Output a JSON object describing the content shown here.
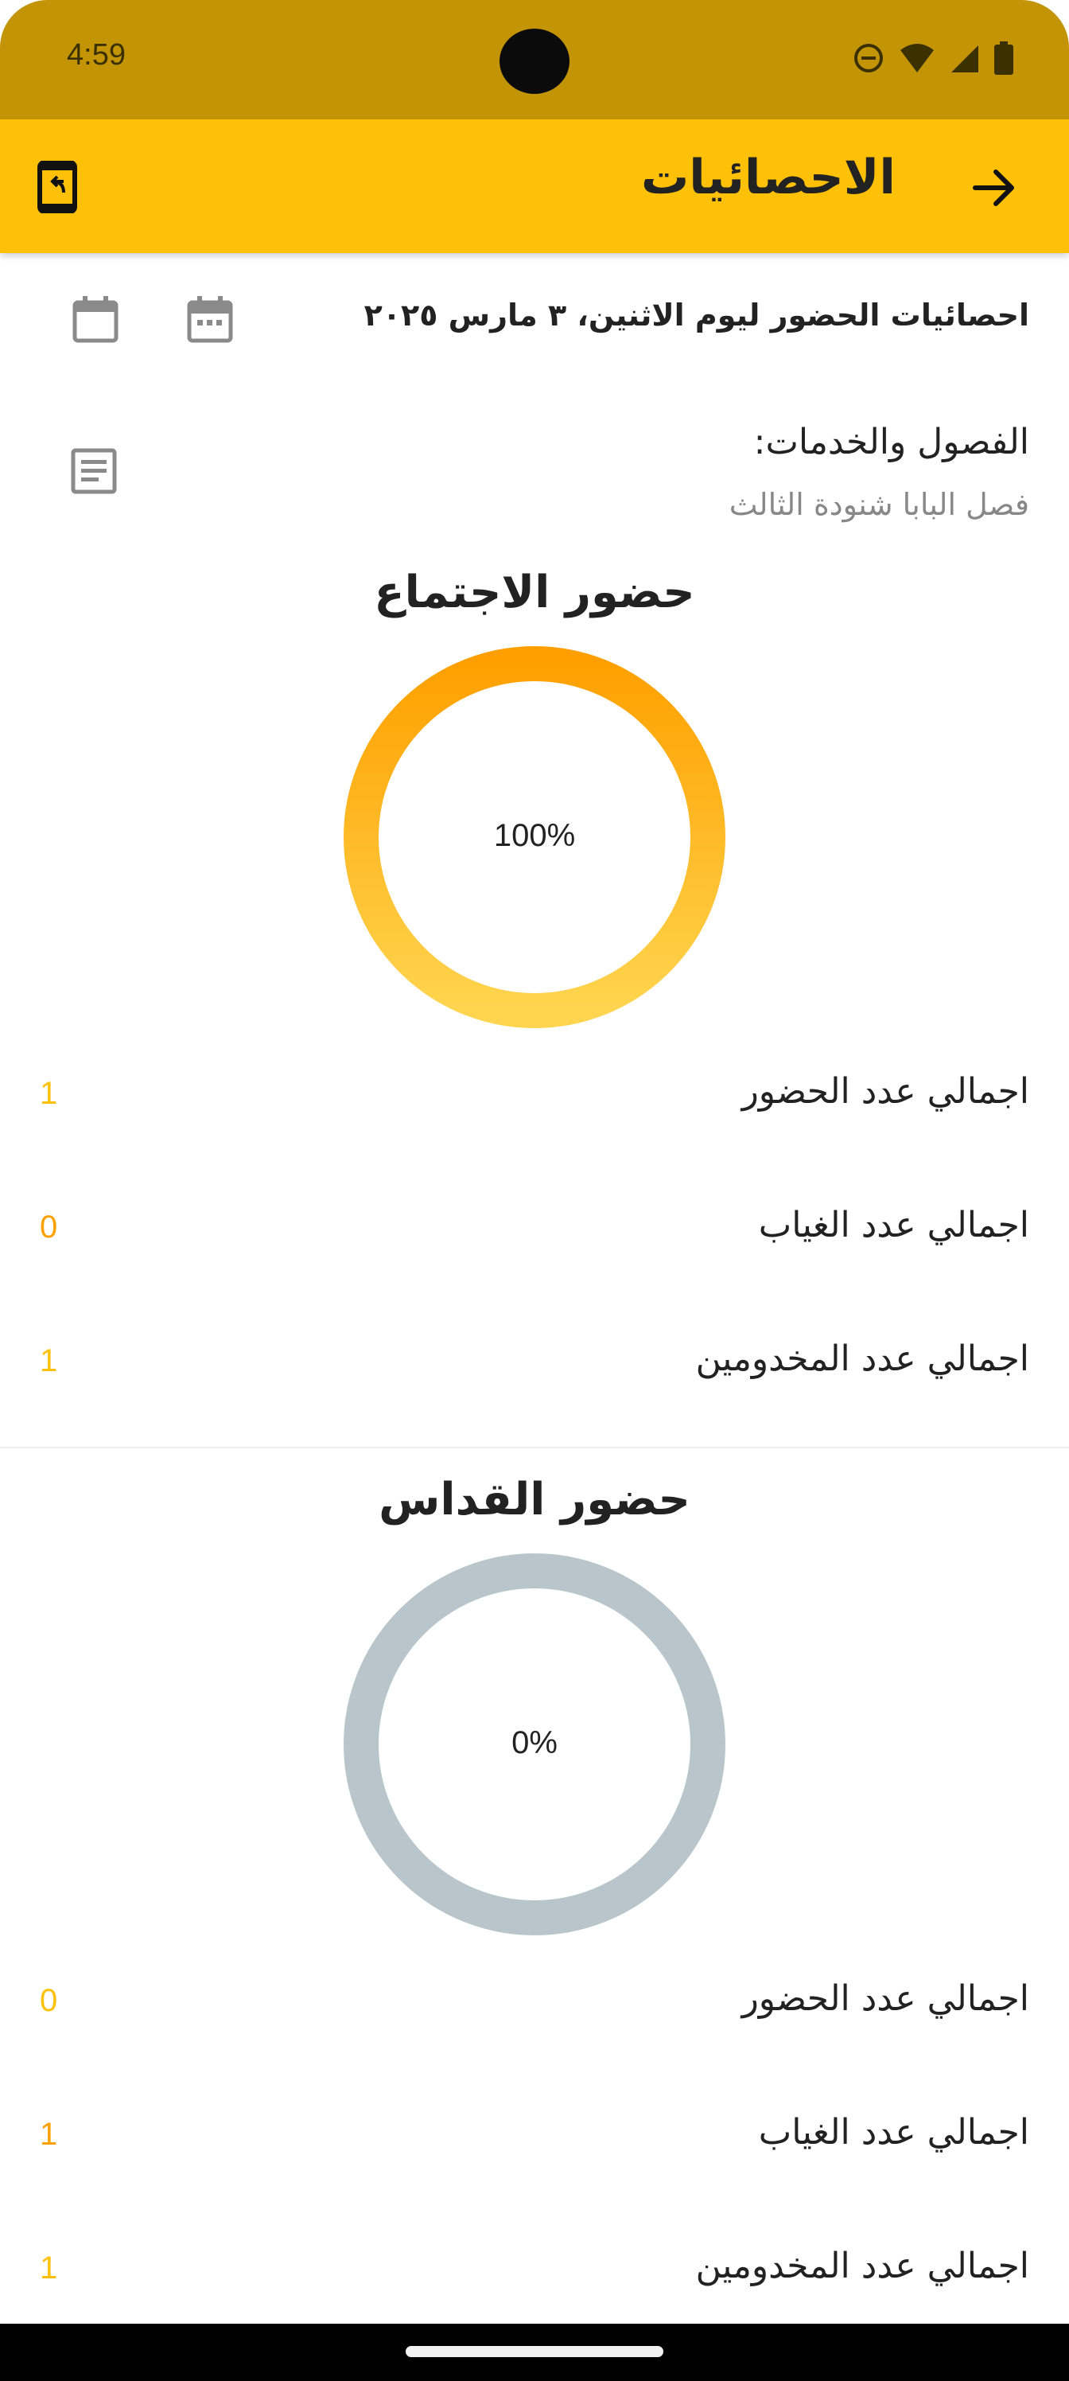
{
  "status_bar": {
    "time": "4:59",
    "icons": [
      "do-not-disturb-icon",
      "wifi-icon",
      "signal-icon",
      "battery-icon"
    ]
  },
  "app_bar": {
    "title": "الاحصائيات",
    "back_icon": "arrow-forward-icon",
    "export_icon": "phone-export-icon",
    "background_color": "#ffc107"
  },
  "header": {
    "title": "احصائيات الحضور ليوم الاثنين، ٣ مارس ٢٠٢٥",
    "icons": [
      "calendar-range-icon",
      "calendar-day-icon"
    ]
  },
  "classes": {
    "label": "الفصول والخدمات:",
    "value": "فصل البابا شنودة الثالث",
    "icon": "list-icon"
  },
  "meeting": {
    "title": "حضور الاجتماع",
    "percent_label": "100%",
    "percent": 100,
    "ring_colors": [
      "#ffd54f",
      "#ffa000"
    ],
    "stats": [
      {
        "label": "اجمالي عدد الحضور",
        "value": "1",
        "color": "#ffc107"
      },
      {
        "label": "اجمالي عدد الغياب",
        "value": "0",
        "color": "#ffa000"
      },
      {
        "label": "اجمالي عدد المخدومين",
        "value": "1",
        "color": "#ffc107"
      }
    ]
  },
  "mass": {
    "title": "حضور القداس",
    "percent_label": "0%",
    "percent": 0,
    "ring_color": "#b8c6cc",
    "stats": [
      {
        "label": "اجمالي عدد الحضور",
        "value": "0",
        "color": "#ffc107"
      },
      {
        "label": "اجمالي عدد الغياب",
        "value": "1",
        "color": "#ffa000"
      },
      {
        "label": "اجمالي عدد المخدومين",
        "value": "1",
        "color": "#ffc107"
      }
    ]
  }
}
